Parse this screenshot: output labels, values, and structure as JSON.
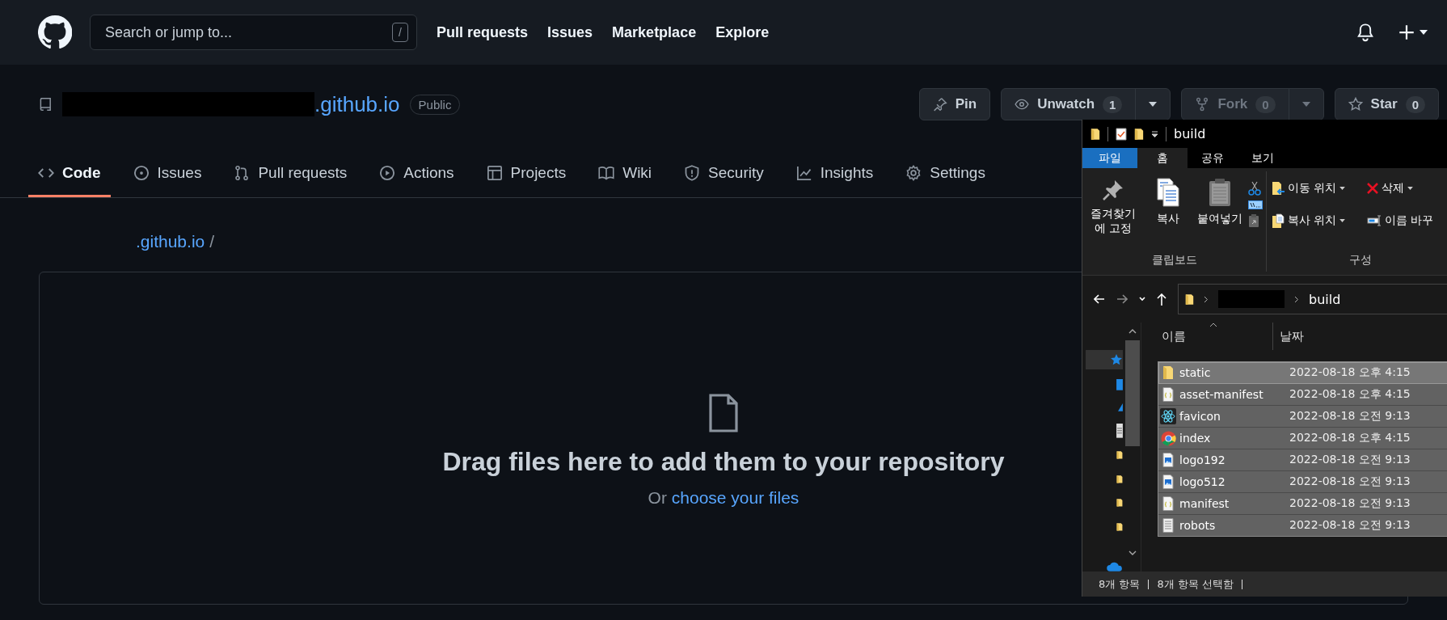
{
  "header": {
    "search_placeholder": "Search or jump to...",
    "search_key": "/",
    "nav": [
      "Pull requests",
      "Issues",
      "Marketplace",
      "Explore"
    ]
  },
  "repo": {
    "name": ".github.io",
    "visibility": "Public",
    "actions": [
      {
        "kind": "pin",
        "label": "Pin",
        "disabled": false
      },
      {
        "kind": "watch",
        "label": "Unwatch",
        "count": "1",
        "dropdown": true,
        "disabled": false
      },
      {
        "kind": "fork",
        "label": "Fork",
        "count": "0",
        "dropdown": true,
        "disabled": true
      },
      {
        "kind": "star",
        "label": "Star",
        "count": "0",
        "disabled": false
      }
    ]
  },
  "tabs": [
    {
      "kind": "code",
      "label": "Code",
      "selected": true
    },
    {
      "kind": "issues",
      "label": "Issues",
      "selected": false
    },
    {
      "kind": "pulls",
      "label": "Pull requests",
      "selected": false
    },
    {
      "kind": "actions",
      "label": "Actions",
      "selected": false
    },
    {
      "kind": "projects",
      "label": "Projects",
      "selected": false
    },
    {
      "kind": "wiki",
      "label": "Wiki",
      "selected": false
    },
    {
      "kind": "security",
      "label": "Security",
      "selected": false
    },
    {
      "kind": "insights",
      "label": "Insights",
      "selected": false
    },
    {
      "kind": "settings",
      "label": "Settings",
      "selected": false
    }
  ],
  "breadcrumb": {
    "repo": ".github.io",
    "separator": "/"
  },
  "upload": {
    "title": "Drag files here to add them to your repository",
    "prefix": "Or",
    "link": "choose your files"
  },
  "explorer": {
    "title": "build",
    "ribbon_tabs": [
      {
        "kind": "file",
        "label": "파일",
        "selected": false
      },
      {
        "kind": "tab",
        "label": "홈",
        "selected": true
      },
      {
        "kind": "tab",
        "label": "공유",
        "selected": false
      },
      {
        "kind": "tab",
        "label": "보기",
        "selected": false
      }
    ],
    "clipboard": {
      "label": "클립보드",
      "buttons": [
        {
          "kind": "pin",
          "label": "즐겨찾기에 고정"
        },
        {
          "kind": "copy",
          "label": "복사"
        },
        {
          "kind": "paste",
          "label": "붙여넣기"
        }
      ]
    },
    "organize": {
      "label": "구성",
      "buttons": [
        {
          "kind": "move",
          "label": "이동 위치",
          "dropdown": true
        },
        {
          "kind": "delete",
          "label": "삭제",
          "dropdown": true
        },
        {
          "kind": "copyto",
          "label": "복사 위치",
          "dropdown": true
        },
        {
          "kind": "rename",
          "label": "이름 바꾸",
          "dropdown": false
        }
      ]
    },
    "address": "build",
    "columns": [
      "이름",
      "날짜"
    ],
    "files": [
      {
        "kind": "folder",
        "name": "static",
        "date": "2022-08-18 오후 4:15",
        "selected": true,
        "focused": true
      },
      {
        "kind": "json",
        "name": "asset-manifest",
        "date": "2022-08-18 오후 4:15",
        "selected": true,
        "focused": false
      },
      {
        "kind": "react",
        "name": "favicon",
        "date": "2022-08-18 오전 9:13",
        "selected": true,
        "focused": false
      },
      {
        "kind": "chrome",
        "name": "index",
        "date": "2022-08-18 오후 4:15",
        "selected": true,
        "focused": false
      },
      {
        "kind": "image",
        "name": "logo192",
        "date": "2022-08-18 오전 9:13",
        "selected": true,
        "focused": false
      },
      {
        "kind": "image",
        "name": "logo512",
        "date": "2022-08-18 오전 9:13",
        "selected": true,
        "focused": false
      },
      {
        "kind": "json",
        "name": "manifest",
        "date": "2022-08-18 오전 9:13",
        "selected": true,
        "focused": false
      },
      {
        "kind": "text",
        "name": "robots",
        "date": "2022-08-18 오전 9:13",
        "selected": true,
        "focused": false
      }
    ],
    "status": [
      "8개 항목",
      "8개 항목 선택함"
    ]
  }
}
